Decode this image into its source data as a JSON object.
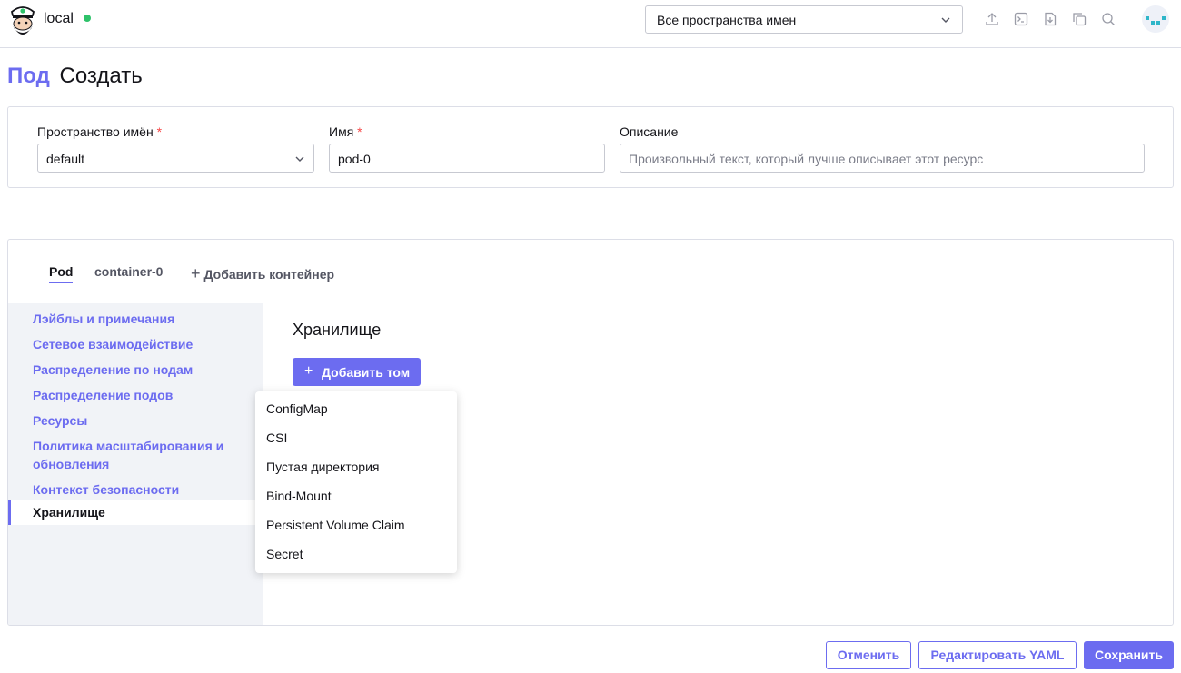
{
  "header": {
    "cluster_name": "local",
    "namespace_select": "Все пространства имен",
    "icons": [
      "import-yaml-icon",
      "kubectl-shell-icon",
      "download-kubeconfig-icon",
      "copy-kubeconfig-icon",
      "search-icon"
    ],
    "status_color": "#2ec26a"
  },
  "page": {
    "resource": "Под",
    "action": "Создать"
  },
  "meta": {
    "namespace_label": "Пространство имён",
    "namespace_value": "default",
    "name_label": "Имя",
    "name_value": "pod-0",
    "description_label": "Описание",
    "description_placeholder": "Произвольный текст, который лучше описывает этот ресурс",
    "required_mark": "*"
  },
  "tabs": {
    "pod": "Pod",
    "container": "container-0",
    "add_container": "Добавить контейнер"
  },
  "side_nav": {
    "labels": "Лэйблы и примечания",
    "networking": "Сетевое взаимодействие",
    "node_scheduling": "Распределение по нодам",
    "pod_scheduling": "Распределение подов",
    "resources": "Ресурсы",
    "scaling_line1": "Политика масштабирования и",
    "scaling_line2": "обновления",
    "security": "Контекст безопасности",
    "storage": "Хранилище"
  },
  "storage": {
    "title": "Хранилище",
    "add_volume": "Добавить том"
  },
  "volume_types": [
    "ConfigMap",
    "CSI",
    "Пустая директория",
    "Bind-Mount",
    "Persistent Volume Claim",
    "Secret"
  ],
  "footer": {
    "cancel": "Отменить",
    "edit_yaml": "Редактировать YAML",
    "save": "Сохранить"
  },
  "colors": {
    "accent": "#6c6cf0",
    "required": "#f64747"
  }
}
